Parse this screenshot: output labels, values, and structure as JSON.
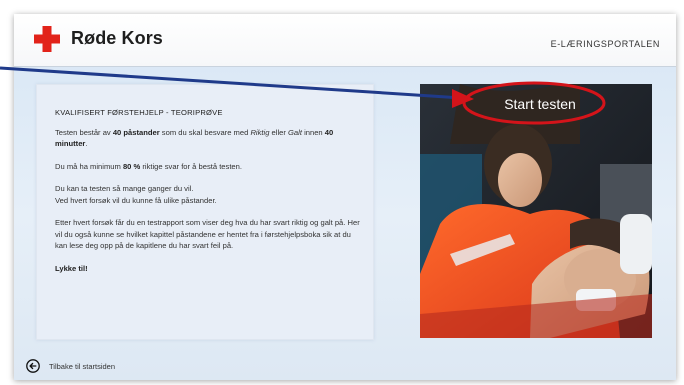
{
  "header": {
    "brand": "Røde Kors",
    "portal_label": "E-LÆRINGSPORTALEN"
  },
  "info": {
    "title": "KVALIFISERT FØRSTEHJELP - TEORIPRØVE",
    "p1": {
      "t1": "Testen består av ",
      "b1": "40 påstander",
      "t2": " som du skal besvare med ",
      "i1": "Riktig",
      "t3": " eller ",
      "i2": "Galt",
      "t4": " innen ",
      "b2": "40 minutter",
      "t5": "."
    },
    "p2": {
      "t1": "Du må ha minimum ",
      "b1": "80 %",
      "t2": " riktige svar for å bestå testen."
    },
    "p3": {
      "line1": "Du kan ta testen så mange ganger du vil.",
      "line2": "Ved hvert forsøk vil du kunne få ulike påstander."
    },
    "p4": "Etter hvert forsøk får du en testrapport som viser deg hva du har svart riktig og galt på. Her vil du også kunne se hvilket kapittel påstandene er hentet fra i førstehjelpsboka sik at du kan lese deg opp på de kapitlene du har svart feil på.",
    "closing": "Lykke til!"
  },
  "media": {
    "start_label": "Start testen"
  },
  "footer": {
    "back_label": "Tilbake til startsiden"
  },
  "colors": {
    "brand_red": "#e2231a",
    "annotation_red": "#d4141a"
  }
}
